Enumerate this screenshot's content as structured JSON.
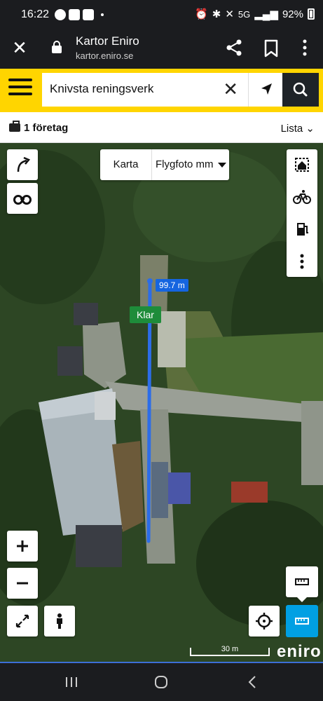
{
  "status_bar": {
    "time": "16:22",
    "battery_text": "92%",
    "network": "5G",
    "icons": [
      "messenger-icon",
      "youtube-icon",
      "linkedin-icon",
      "alarm-icon",
      "bluetooth-icon",
      "mute-icon",
      "signal-icon",
      "battery-icon"
    ]
  },
  "browser": {
    "title": "Kartor Eniro",
    "url": "kartor.eniro.se"
  },
  "search": {
    "value": "Knivsta reningsverk",
    "clear_icon": "close-icon",
    "locate_icon": "navigation-arrow-icon",
    "search_icon": "search-icon"
  },
  "results": {
    "count_label": "1 företag",
    "list_label": "Lista"
  },
  "map": {
    "type_toggle": {
      "map_label": "Karta",
      "satellite_label": "Flygfoto mm"
    },
    "measure": {
      "distance_label": "99.7 m",
      "done_label": "Klar"
    },
    "scale_label": "30 m",
    "logo_text": "eniro"
  },
  "colors": {
    "header_yellow": "#ffd500",
    "measure_blue": "#1565e0",
    "done_green": "#1e8c3a",
    "active_tool": "#00a0e3"
  }
}
